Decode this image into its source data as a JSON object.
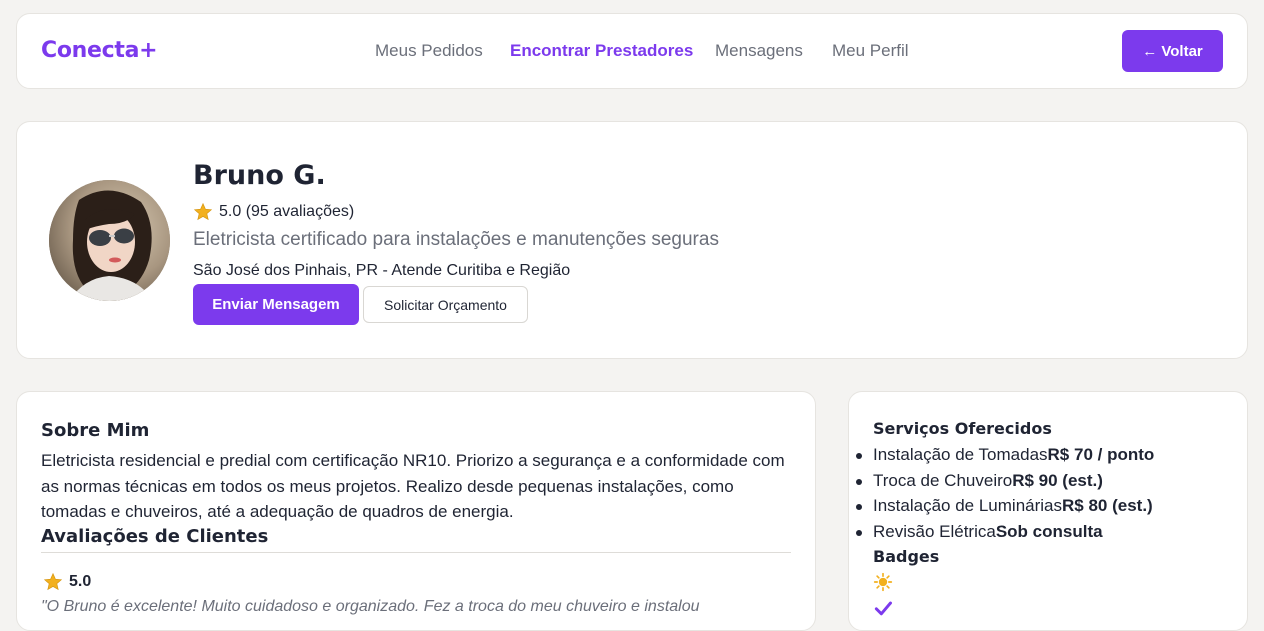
{
  "header": {
    "logo": "Conecta+",
    "nav": [
      {
        "label": "Meus Pedidos",
        "active": false
      },
      {
        "label": "Encontrar Prestadores",
        "active": true
      },
      {
        "label": "Mensagens",
        "active": false
      },
      {
        "label": "Meu Perfil",
        "active": false
      }
    ],
    "back_label": "← Voltar"
  },
  "profile": {
    "name": "Bruno G.",
    "rating": "5.0 (95 avaliações)",
    "tagline": "Eletricista certificado para instalações e manutenções seguras",
    "location": "São José dos Pinhais, PR - Atende Curitiba e Região",
    "message_button": "Enviar Mensagem",
    "quote_button": "Solicitar Orçamento"
  },
  "about": {
    "title": "Sobre Mim",
    "text": "Eletricista residencial e predial com certificação NR10. Priorizo a segurança e a conformidade com as normas técnicas em todos os meus projetos. Realizo desde pequenas instalações, como tomadas e chuveiros, até a adequação de quadros de energia."
  },
  "reviews": {
    "title": "Avaliações de Clientes",
    "items": [
      {
        "rating": "5.0",
        "text": "\"O Bruno é excelente! Muito cuidadoso e organizado. Fez a troca do meu chuveiro e instalou"
      }
    ]
  },
  "services": {
    "title": "Serviços Oferecidos",
    "items": [
      {
        "name": "Instalação de Tomadas",
        "price": "R$ 70 / ponto"
      },
      {
        "name": "Troca de Chuveiro",
        "price": "R$ 90 (est.)"
      },
      {
        "name": "Instalação de Luminárias",
        "price": "R$ 80 (est.)"
      },
      {
        "name": "Revisão Elétrica",
        "price": "Sob consulta"
      }
    ],
    "badges_title": "Badges",
    "badges": [
      "sun-badge-icon",
      "check-badge-icon"
    ]
  },
  "colors": {
    "accent": "#7c3aed",
    "star": "#f2b01e",
    "text": "#1f2433",
    "muted": "#6b6f7a",
    "background": "#f4f3f1"
  }
}
